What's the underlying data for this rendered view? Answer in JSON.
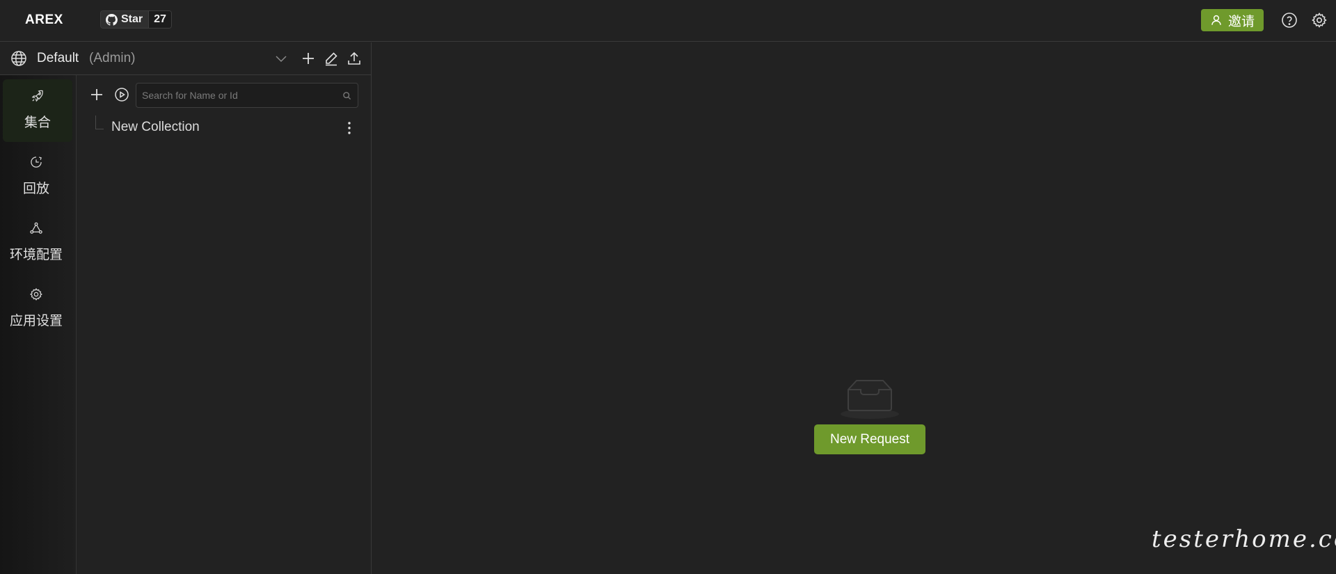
{
  "header": {
    "logo": "AREX",
    "github": {
      "star_label": "Star",
      "star_count": "27"
    },
    "invite_label": "邀请"
  },
  "workspace": {
    "name": "Default",
    "role": "(Admin)"
  },
  "nav": {
    "items": [
      {
        "label": "集合",
        "icon": "rocket-icon",
        "active": true
      },
      {
        "label": "回放",
        "icon": "replay-clock-icon",
        "active": false
      },
      {
        "label": "环境配置",
        "icon": "environment-icon",
        "active": false
      },
      {
        "label": "应用设置",
        "icon": "gear-icon",
        "active": false
      }
    ]
  },
  "collection": {
    "search_placeholder": "Search for Name or Id",
    "items": [
      {
        "label": "New Collection"
      }
    ]
  },
  "main": {
    "new_request_label": "New Request"
  },
  "watermark": "testerhome.com",
  "colors": {
    "background": "#222222",
    "accent": "#6f9a2c",
    "nav_active": "#1c2418",
    "border": "#3a3a3a"
  }
}
